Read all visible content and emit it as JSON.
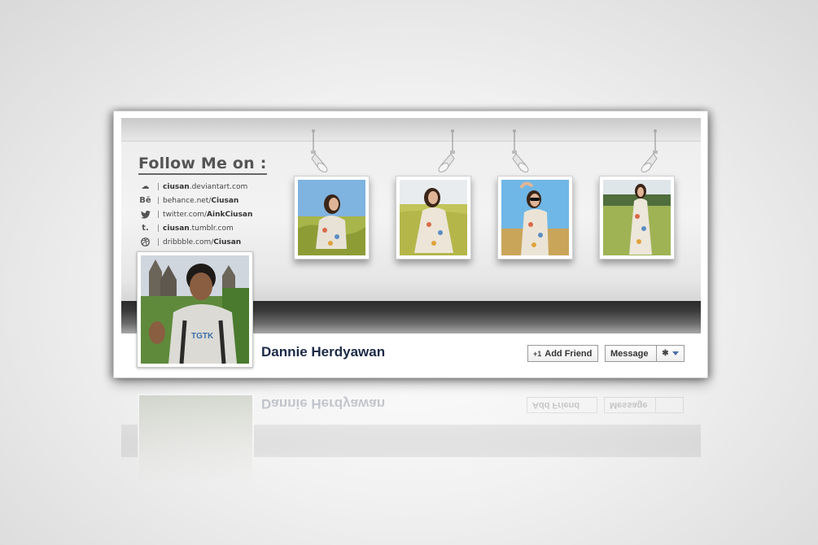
{
  "cover": {
    "follow_title": "Follow Me on :",
    "links": [
      {
        "icon": "deviantart-icon",
        "glyph": "☁",
        "bold": "ciusan",
        "text": ".deviantart.com",
        "bold_first": true
      },
      {
        "icon": "behance-icon",
        "glyph": "Bē",
        "bold": "Ciusan",
        "text": "behance.net/",
        "bold_first": false
      },
      {
        "icon": "twitter-icon",
        "glyph": "🐦",
        "bold": "AinkCiusan",
        "text": "twitter.com/",
        "bold_first": false
      },
      {
        "icon": "tumblr-icon",
        "glyph": "t.",
        "bold": "ciusan",
        "text": ".tumblr.com",
        "bold_first": true
      },
      {
        "icon": "dribbble-icon",
        "glyph": "⊛",
        "bold": "Ciusan",
        "text": "dribbble.com/",
        "bold_first": false
      }
    ]
  },
  "profile": {
    "name": "Dannie Herdyawan"
  },
  "actions": {
    "add_friend_label": "Add Friend",
    "add_friend_icon": "+1",
    "message_label": "Message"
  },
  "colors": {
    "name": "#1c2a47",
    "caret": "#4a6ea9"
  }
}
